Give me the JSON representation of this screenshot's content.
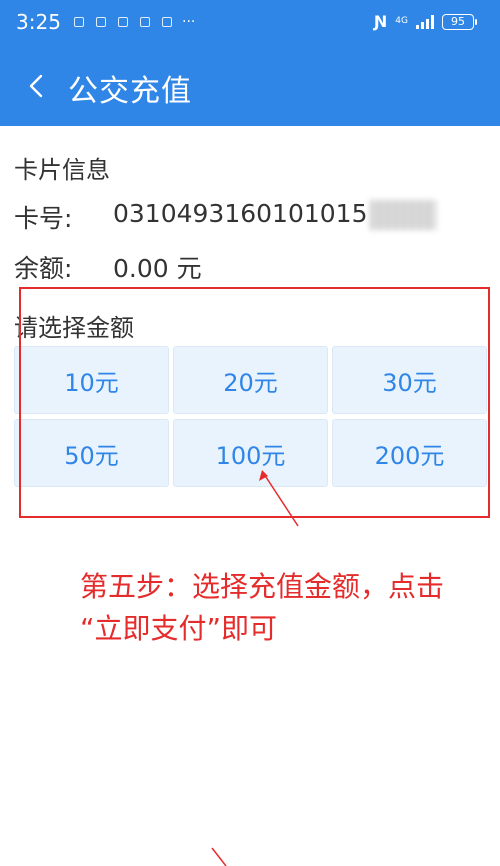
{
  "status_bar": {
    "time": "3:25",
    "network": "4G",
    "battery": "95"
  },
  "header": {
    "title": "公交充值"
  },
  "card_info": {
    "title": "卡片信息",
    "card_no_label": "卡号:",
    "card_no_value": "0310493160101015",
    "balance_label": "余额:",
    "balance_value": "0.00 元"
  },
  "amounts": {
    "title": "请选择金额",
    "options": [
      "10元",
      "20元",
      "30元",
      "50元",
      "100元",
      "200元"
    ]
  },
  "annotation": {
    "line1": "第五步：选择充值金额，点击",
    "line2": "“立即支付”即可",
    "color": "#e52c2c"
  },
  "colors": {
    "primary": "#2f86e6",
    "button_bg": "#e9f3fd"
  }
}
